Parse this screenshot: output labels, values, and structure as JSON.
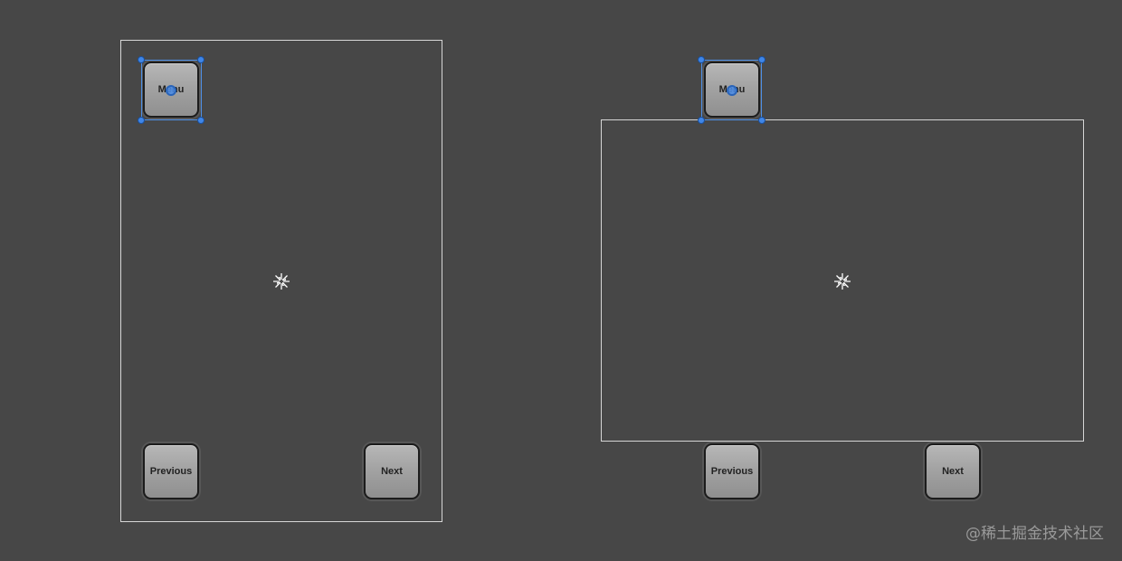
{
  "colors": {
    "background": "#474747",
    "frame_border": "#d6d6d6",
    "selection": "#3f86e8"
  },
  "views": [
    {
      "menu_label": "Menu",
      "previous_label": "Previous",
      "next_label": "Next",
      "anchor_icon": "anchor-gizmo-icon"
    },
    {
      "menu_label": "Menu",
      "previous_label": "Previous",
      "next_label": "Next",
      "anchor_icon": "anchor-gizmo-icon"
    }
  ],
  "watermark": "@稀土掘金技术社区"
}
